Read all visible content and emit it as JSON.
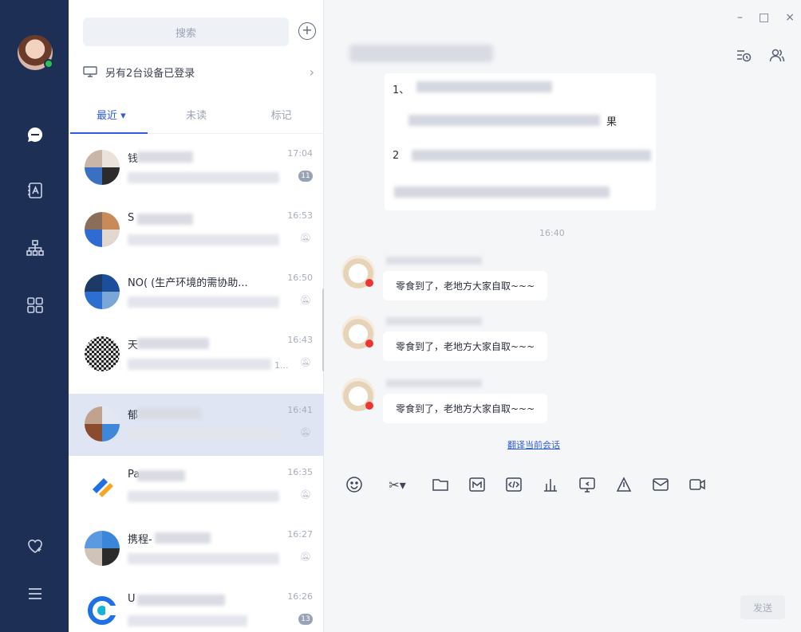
{
  "window": {
    "minimize": "–",
    "maximize": "□",
    "close": "×"
  },
  "list": {
    "search": {
      "placeholder": "搜索"
    },
    "devices_text": "另有2台设备已登录",
    "tabs": [
      {
        "label": "最近 ▾"
      },
      {
        "label": "未读"
      },
      {
        "label": "标记"
      }
    ],
    "conversations": [
      {
        "name": "钱",
        "time": "17:04",
        "badge": "11"
      },
      {
        "name": "S",
        "time": "16:53"
      },
      {
        "name": "NO( (生产环境的需协助...",
        "time": "16:50"
      },
      {
        "name": "天",
        "time": "16:43",
        "preview_tail": "1..."
      },
      {
        "name": "郁",
        "time": "16:41"
      },
      {
        "name": "Pa",
        "time": "16:35"
      },
      {
        "name": "携程-",
        "time": "16:27"
      },
      {
        "name": "U",
        "time": "16:26",
        "badge": "13"
      }
    ]
  },
  "chat": {
    "card_lines": [
      "1、",
      "果",
      "2"
    ],
    "timestamp": "16:40",
    "messages": [
      {
        "text": "零食到了，老地方大家自取~~~"
      },
      {
        "text": "零食到了，老地方大家自取~~~"
      },
      {
        "text": "零食到了，老地方大家自取~~~"
      }
    ],
    "ai_link": "翻译当前会话",
    "send_label": "发送"
  },
  "colors": {
    "rail": "#1d2f55",
    "accent": "#2f5cd8",
    "selected": "#dfe5f3"
  }
}
